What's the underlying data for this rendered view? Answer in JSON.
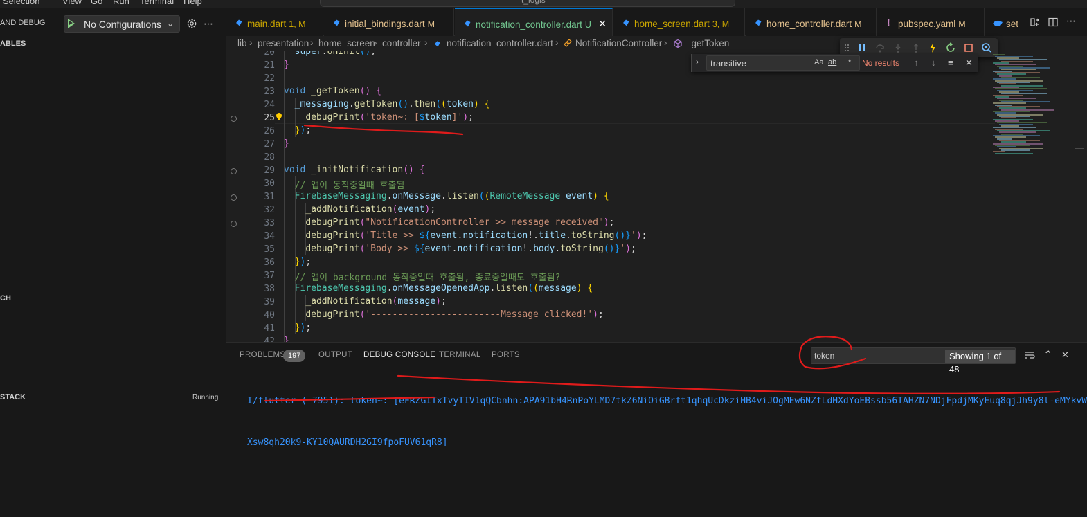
{
  "menubar": {
    "items": [
      "Selection",
      "View",
      "Go",
      "Run",
      "Terminal",
      "Help"
    ],
    "title": "t_logis"
  },
  "sidebar": {
    "run_title": "AND DEBUG",
    "config_label": "No Configurations",
    "sections": {
      "variables": "ABLES",
      "watch": "CH",
      "callstack": "STACK"
    },
    "callstack_status": "Running"
  },
  "tabs": [
    {
      "label": "main.dart",
      "status": "1, M",
      "color": "#cca700",
      "active": false
    },
    {
      "label": "initial_bindings.dart",
      "status": "M",
      "color": "#e2c08d",
      "active": false
    },
    {
      "label": "notification_controller.dart",
      "status": "U",
      "color": "#73c991",
      "active": true
    },
    {
      "label": "home_screen.dart",
      "status": "3, M",
      "color": "#cca700",
      "active": false
    },
    {
      "label": "home_controller.dart",
      "status": "M",
      "color": "#e2c08d",
      "active": false
    },
    {
      "label": "pubspec.yaml",
      "status": "M",
      "color": "#e2c08d",
      "active": false
    },
    {
      "label": "set",
      "status": "",
      "color": "#e2c08d",
      "active": false
    }
  ],
  "breadcrumb": [
    "lib",
    "presentation",
    "home_screen",
    "controller",
    "notification_controller.dart",
    "NotificationController",
    "_getToken"
  ],
  "editor": {
    "current_line": 25,
    "lines": [
      {
        "n": "20",
        "bp": false
      },
      {
        "n": "21",
        "bp": false
      },
      {
        "n": "22",
        "bp": false
      },
      {
        "n": "23",
        "bp": false
      },
      {
        "n": "24",
        "bp": false
      },
      {
        "n": "25",
        "bp": true
      },
      {
        "n": "26",
        "bp": false
      },
      {
        "n": "27",
        "bp": false
      },
      {
        "n": "28",
        "bp": false
      },
      {
        "n": "29",
        "bp": true
      },
      {
        "n": "30",
        "bp": false
      },
      {
        "n": "31",
        "bp": true
      },
      {
        "n": "32",
        "bp": false
      },
      {
        "n": "33",
        "bp": true
      },
      {
        "n": "34",
        "bp": false
      },
      {
        "n": "35",
        "bp": false
      },
      {
        "n": "36",
        "bp": false
      },
      {
        "n": "37",
        "bp": false
      },
      {
        "n": "38",
        "bp": false
      },
      {
        "n": "39",
        "bp": false
      },
      {
        "n": "40",
        "bp": false
      },
      {
        "n": "41",
        "bp": false
      },
      {
        "n": "42",
        "bp": false
      }
    ]
  },
  "find_widget": {
    "value": "transitive",
    "status": "No results",
    "opt_case": "Aa",
    "opt_word": "ab",
    "opt_regex": ".*"
  },
  "panel": {
    "tabs": [
      "PROBLEMS",
      "OUTPUT",
      "DEBUG CONSOLE",
      "TERMINAL",
      "PORTS"
    ],
    "active_tab": "DEBUG CONSOLE",
    "problems_count": "197",
    "filter_value": "token",
    "filter_count": "Showing 1 of 48",
    "output_lines": [
      "I/flutter ( 7951): token~: [eFRZGITxTvyTIV1qQCbnhn:APA91bH4RnPoYLMD7tkZ6NiOiGBrft1qhqUcDkziHB4viJOgMEw6NZfLdHXdYoEBssb56TAHZN7NDjFpdjMKyEuq8qjJh9y8l-eMYkvW",
      "Xsw8qh20k9-KY10QAURDH2GI9fpoFUV61qR8]"
    ]
  },
  "colors": {
    "accent": "#0078d4",
    "annotation": "#e01b1b",
    "console_text": "#3794ff"
  }
}
